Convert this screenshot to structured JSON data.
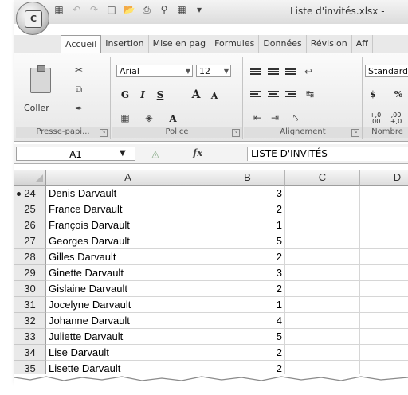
{
  "window": {
    "title": "Liste d'invités.xlsx -",
    "office_button_logo": "C"
  },
  "quick_access": [
    "save-icon",
    "undo-icon",
    "redo-icon",
    "new-icon",
    "open-icon",
    "print-icon",
    "print-preview-icon",
    "table-icon",
    "customize-icon"
  ],
  "tabs": [
    "Accueil",
    "Insertion",
    "Mise en pag",
    "Formules",
    "Données",
    "Révision",
    "Aff"
  ],
  "active_tab": "Accueil",
  "ribbon": {
    "clipboard": {
      "paste_label": "Coller",
      "group_label": "Presse-papi..."
    },
    "font": {
      "font_name": "Arial",
      "font_size": "12",
      "bold": "G",
      "italic": "I",
      "underline": "S",
      "grow": "A",
      "shrink": "A",
      "font_color_letter": "A",
      "group_label": "Police"
    },
    "alignment": {
      "group_label": "Alignement"
    },
    "number": {
      "format": "Standard",
      "currency": "$",
      "percent": "%",
      "dec_inc": "+,0 ,00",
      "dec_dec": ",00 +,0",
      "group_label": "Nombre"
    }
  },
  "formula_bar": {
    "name_box": "A1",
    "fx": "fx",
    "content": "LISTE D'INVITÉS"
  },
  "grid": {
    "columns": [
      "A",
      "B",
      "C",
      "D"
    ],
    "rows": [
      {
        "row": "24",
        "name": "Denis Darvault",
        "count": "3"
      },
      {
        "row": "25",
        "name": "France Darvault",
        "count": "2"
      },
      {
        "row": "26",
        "name": "François Darvault",
        "count": "1"
      },
      {
        "row": "27",
        "name": "Georges Darvault",
        "count": "5"
      },
      {
        "row": "28",
        "name": "Gilles Darvault",
        "count": "2"
      },
      {
        "row": "29",
        "name": "Ginette Darvault",
        "count": "3"
      },
      {
        "row": "30",
        "name": "Gislaine Darvault",
        "count": "2"
      },
      {
        "row": "31",
        "name": "Jocelyne Darvault",
        "count": "1"
      },
      {
        "row": "32",
        "name": "Johanne Darvault",
        "count": "4"
      },
      {
        "row": "33",
        "name": "Juliette Darvault",
        "count": "5"
      },
      {
        "row": "34",
        "name": "Lise Darvault",
        "count": "2"
      },
      {
        "row": "35",
        "name": "Lisette Darvault",
        "count": "2"
      }
    ]
  }
}
